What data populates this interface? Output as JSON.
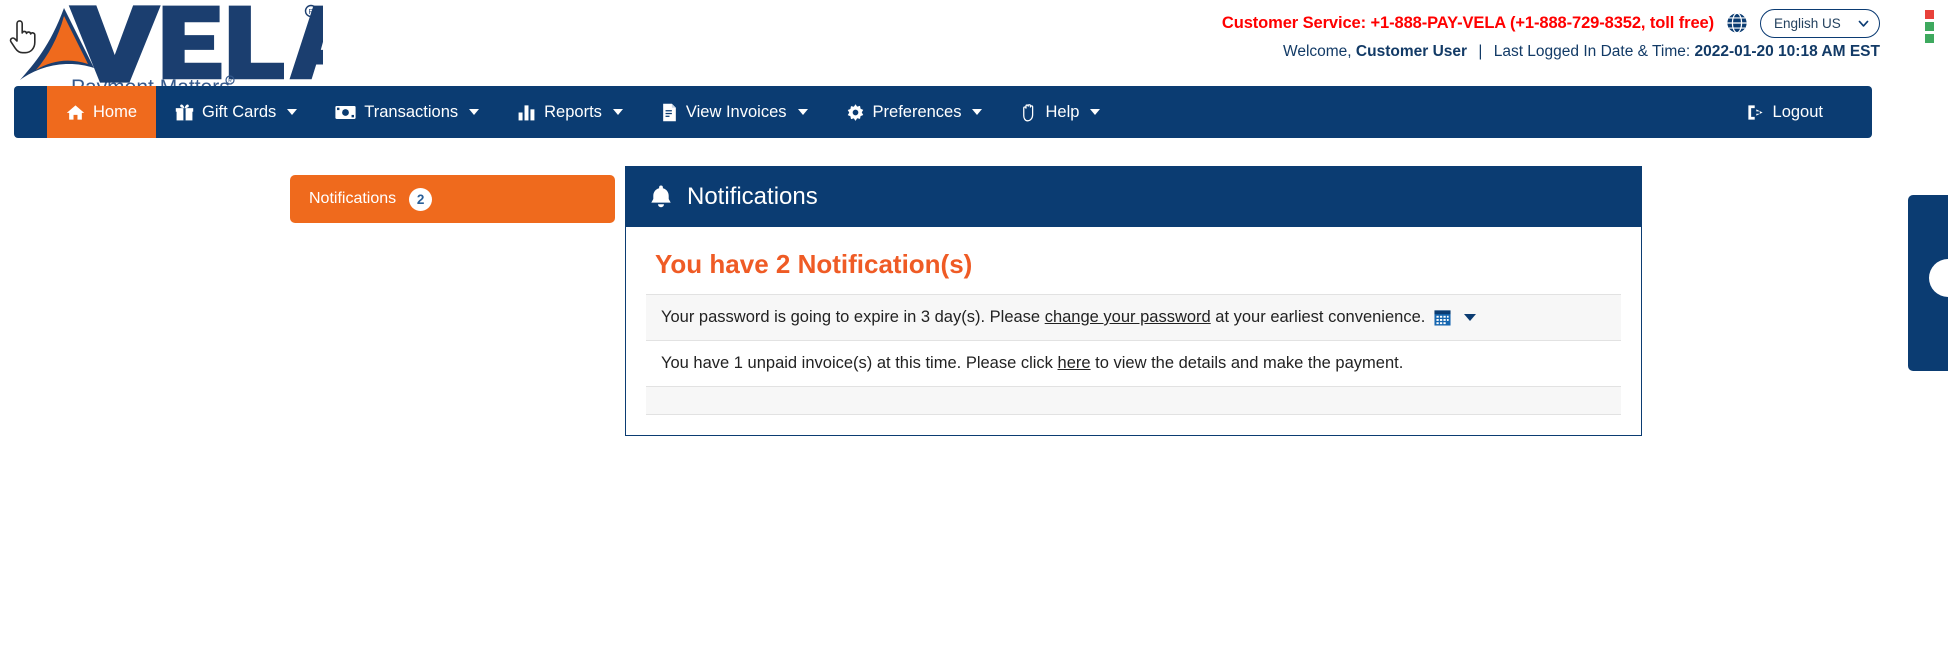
{
  "brand": {
    "name": "VELA",
    "tagline": "Payment Matters",
    "registered": "®",
    "navy": "#0b3c72",
    "orange": "#ef6a1d"
  },
  "header": {
    "customer_service": "Customer Service: +1-888-PAY-VELA (+1-888-729-8352, toll free)",
    "globe_icon": "globe-icon",
    "language": {
      "selected": "English US",
      "options": [
        "English US"
      ],
      "caret_icon": "chevron-down-icon"
    },
    "welcome_prefix": "Welcome,",
    "user_name": "Customer User",
    "separator": "|",
    "last_login_label": "Last Logged In Date & Time:",
    "last_login_value": "2022-01-20 10:18 AM EST"
  },
  "nav": {
    "items": [
      {
        "label": "Home",
        "icon": "home-icon",
        "active": true,
        "caret": false
      },
      {
        "label": "Gift Cards",
        "icon": "gift-icon",
        "active": false,
        "caret": true
      },
      {
        "label": "Transactions",
        "icon": "money-bill-icon",
        "active": false,
        "caret": true
      },
      {
        "label": "Reports",
        "icon": "bar-chart-icon",
        "active": false,
        "caret": true
      },
      {
        "label": "View Invoices",
        "icon": "file-invoice-icon",
        "active": false,
        "caret": true
      },
      {
        "label": "Preferences",
        "icon": "gear-icon",
        "active": false,
        "caret": true
      },
      {
        "label": "Help",
        "icon": "hand-icon",
        "active": false,
        "caret": true
      }
    ],
    "logout": {
      "label": "Logout",
      "icon": "sign-out-icon"
    }
  },
  "side_tab": {
    "label": "Notifications",
    "count": "2"
  },
  "panel": {
    "header_title": "Notifications",
    "header_icon": "bell-icon",
    "summary": "You have 2 Notification(s)",
    "rows": [
      {
        "text_before": "Your password is going to expire in 3 day(s). Please ",
        "link": "change your password",
        "text_after": " at your earliest convenience.",
        "icon": "calendar-icon",
        "caret_icon": "caret-down-icon",
        "shaded": true
      },
      {
        "text_before": "You have 1 unpaid invoice(s) at this time. Please click ",
        "link": "here",
        "text_after": " to view the details and make the payment.",
        "icon": null,
        "caret_icon": null,
        "shaded": false
      },
      {
        "text_before": "",
        "link": "",
        "text_after": "",
        "icon": null,
        "caret_icon": null,
        "shaded": true
      }
    ]
  },
  "edge": {
    "extension_dots": [
      "#e8413a",
      "#3ea95e",
      "#3ea95e"
    ],
    "side_widget_name": "collapsed-chat-widget"
  },
  "cursor": {
    "type": "pointer-hand-cursor"
  }
}
